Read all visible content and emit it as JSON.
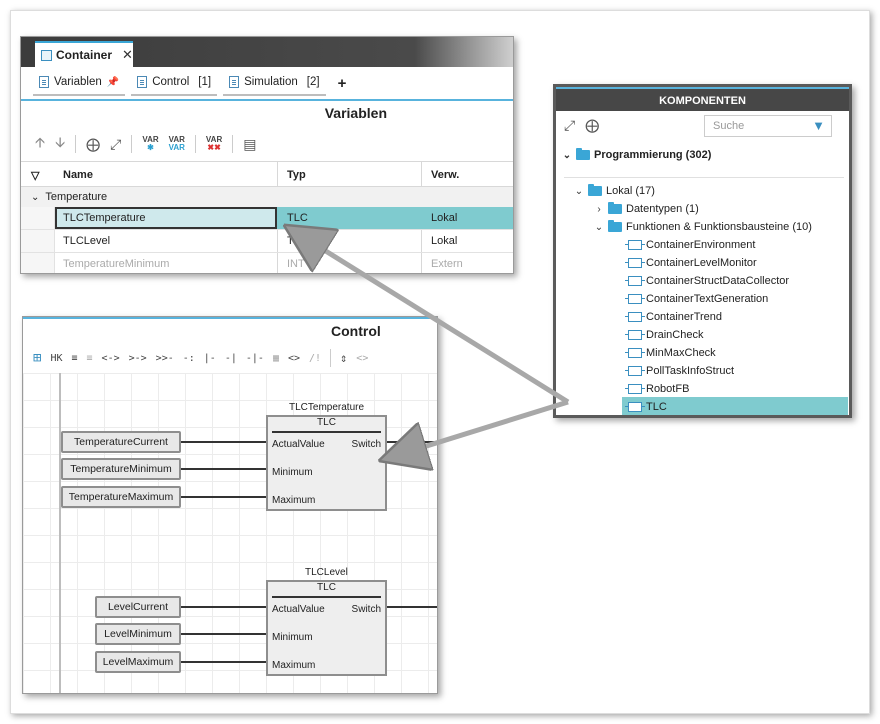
{
  "variables_panel": {
    "container_tab": "Container",
    "close_glyph": "✕",
    "subtabs": [
      {
        "label": "Variablen",
        "badge": ""
      },
      {
        "label": "Control",
        "badge": "[1]"
      },
      {
        "label": "Simulation",
        "badge": "[2]"
      }
    ],
    "pin_glyph": "✦",
    "add_tab": "+",
    "title": "Variablen",
    "toolbar": {
      "var1": "VAR",
      "var2": "VAR",
      "var2b": "VAR",
      "var3": "VAR"
    },
    "columns": {
      "name": "Name",
      "type": "Typ",
      "usage": "Verw."
    },
    "group": "Temperature",
    "rows": [
      {
        "name": "TLCTemperature",
        "type": "TLC",
        "usage": "Lokal"
      },
      {
        "name": "TLCLevel",
        "type": "TLC",
        "usage": "Lokal"
      },
      {
        "name": "TemperatureMinimum",
        "type": "INT",
        "usage": "Extern"
      }
    ]
  },
  "control_panel": {
    "title": "Control",
    "toolbar": [
      "HK",
      "<->",
      ">->",
      ">>-",
      "-:",
      "|-",
      "-|",
      "-|-",
      "<>",
      "/!"
    ],
    "block1": {
      "instance": "TLCTemperature",
      "type": "TLC",
      "inputs": [
        "ActualValue",
        "Minimum",
        "Maximum"
      ],
      "output": "Switch",
      "sources": [
        "TemperatureCurrent",
        "TemperatureMinimum",
        "TemperatureMaximum"
      ]
    },
    "block2": {
      "instance": "TLCLevel",
      "type": "TLC",
      "inputs": [
        "ActualValue",
        "Minimum",
        "Maximum"
      ],
      "output": "Switch",
      "sources": [
        "LevelCurrent",
        "LevelMinimum",
        "LevelMaximum"
      ]
    }
  },
  "components_panel": {
    "title": "KOMPONENTEN",
    "search_placeholder": "Suche",
    "root": "Programmierung (302)",
    "lokal": "Lokal (17)",
    "datatypes": "Datentypen (1)",
    "functions": "Funktionen & Funktionsbausteine (10)",
    "items": [
      "ContainerEnvironment",
      "ContainerLevelMonitor",
      "ContainerStructDataCollector",
      "ContainerTextGeneration",
      "ContainerTrend",
      "DrainCheck",
      "MinMaxCheck",
      "PollTaskInfoStruct",
      "RobotFB",
      "TLC"
    ],
    "selected_item": "TLC"
  },
  "colors": {
    "accent_blue": "#58b3dd",
    "selection_teal": "#7fcbcf",
    "header_dark": "#474747"
  }
}
